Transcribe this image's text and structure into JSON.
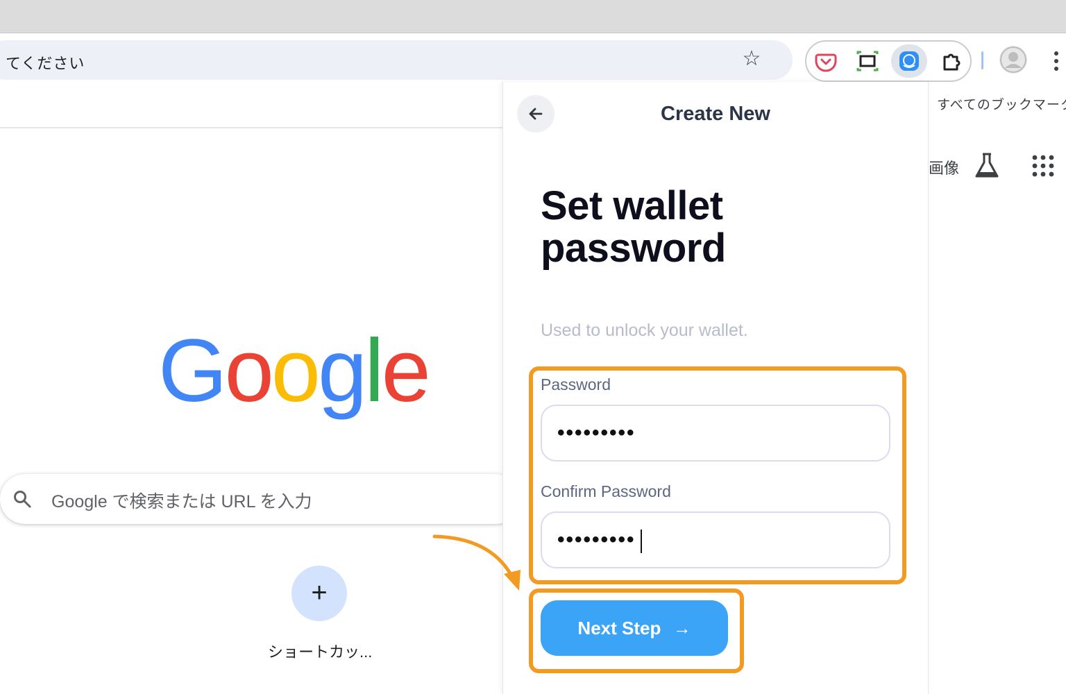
{
  "browser": {
    "omnibox_text": "てください",
    "bookmarks_label": "すべてのブックマーク",
    "images_link": "画像"
  },
  "google": {
    "logo_letters": [
      "G",
      "o",
      "o",
      "g",
      "l",
      "e"
    ],
    "logo_colors": [
      "#4285F4",
      "#EA4335",
      "#FBBC05",
      "#4285F4",
      "#34A853",
      "#EA4335"
    ],
    "search_placeholder": "Google で検索または URL を入力",
    "shortcut_add_symbol": "+",
    "shortcut_label": "ショートカッ..."
  },
  "wallet_popup": {
    "title": "Create New",
    "heading": "Set wallet password",
    "subtitle": "Used to unlock your wallet.",
    "password_label": "Password",
    "password_value": "•••••••••",
    "confirm_label": "Confirm Password",
    "confirm_value": "•••••••••",
    "next_button_label": "Next Step",
    "next_button_arrow": "→",
    "accent_color": "#3ba4f7"
  },
  "annotation": {
    "highlight_color": "#f29a21"
  }
}
